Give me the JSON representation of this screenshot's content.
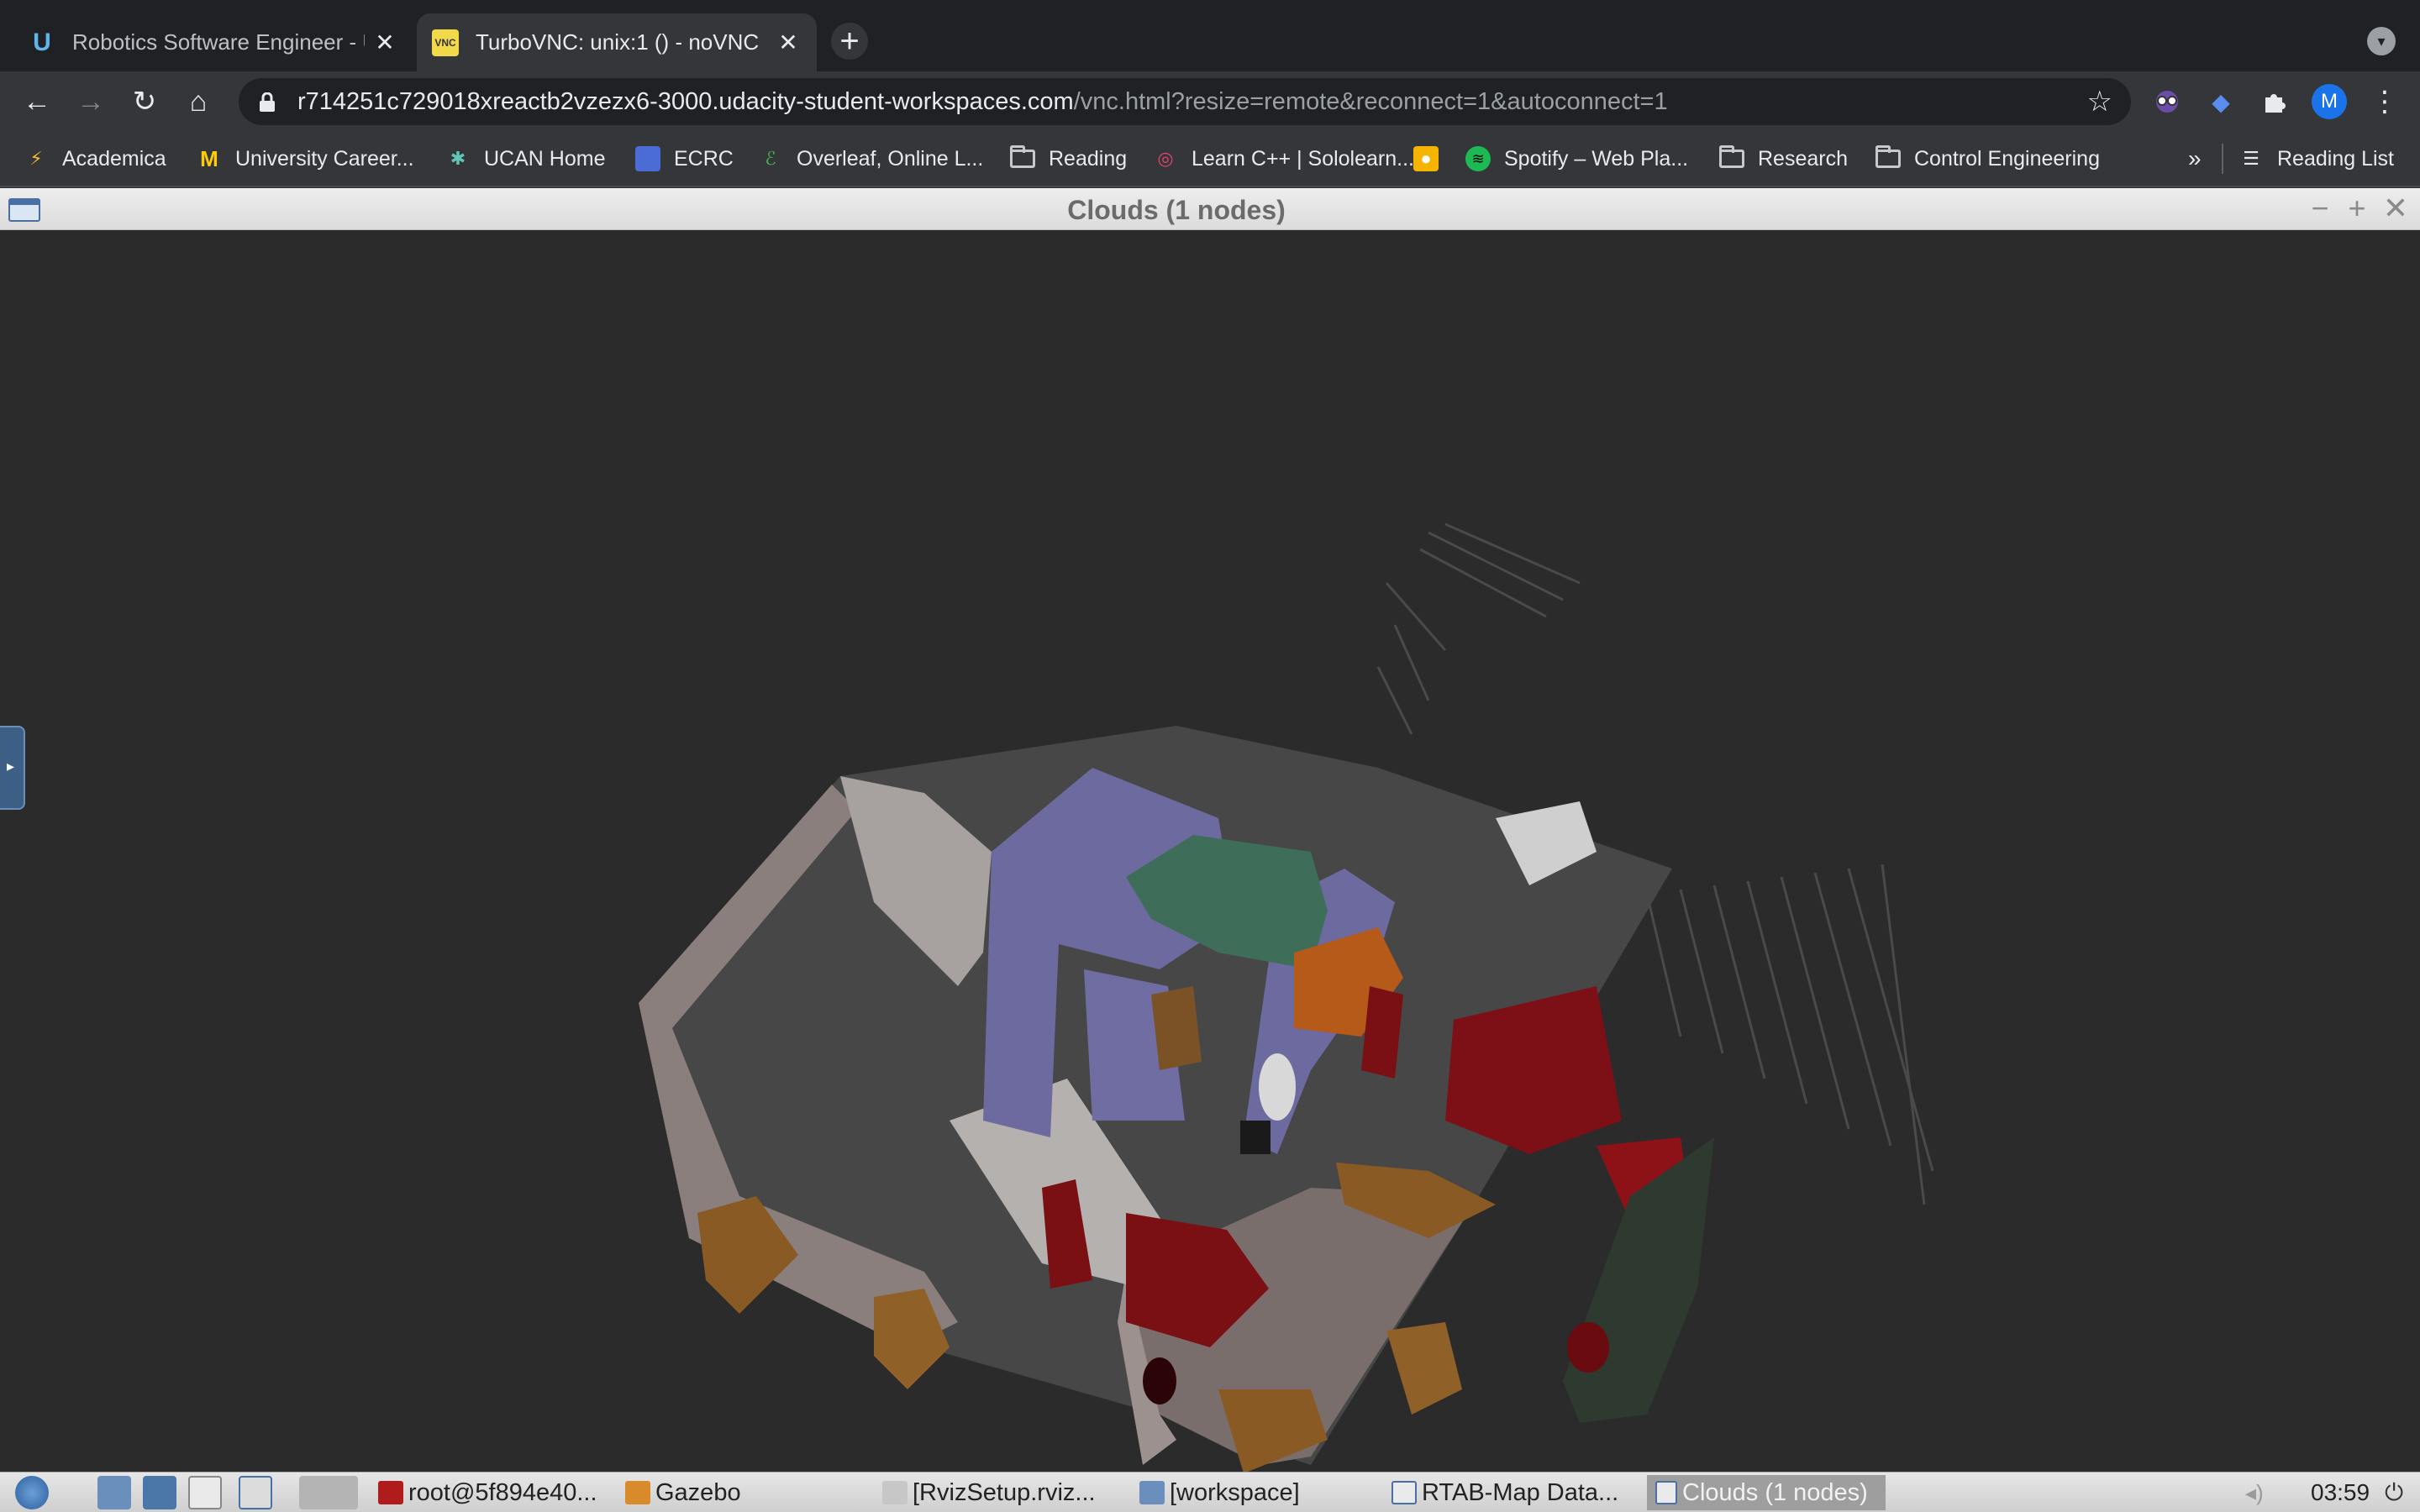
{
  "tabs": [
    {
      "title": "Robotics Software Engineer - U",
      "icon": "udacity-icon",
      "active": false
    },
    {
      "title": "TurboVNC: unix:1 () - noVNC",
      "icon": "vnc-icon",
      "active": true
    }
  ],
  "address": {
    "host": "r714251c729018xreactb2vzezx6-3000.udacity-student-workspaces.com",
    "path": "/vnc.html?resize=remote&reconnect=1&autoconnect=1"
  },
  "profile_initial": "M",
  "bookmarks": [
    {
      "label": "Academica",
      "icon": "academica-icon"
    },
    {
      "label": "University Career...",
      "icon": "michigan-icon"
    },
    {
      "label": "UCAN Home",
      "icon": "ucan-icon"
    },
    {
      "label": "ECRC",
      "icon": "ecrc-icon"
    },
    {
      "label": "Overleaf, Online L...",
      "icon": "overleaf-icon"
    },
    {
      "label": "Reading",
      "icon": "folder-icon"
    },
    {
      "label": "Learn C++ | Sololearn...",
      "icon": "sololearn-icon"
    },
    {
      "label": "",
      "icon": "notes-icon"
    },
    {
      "label": "Spotify – Web Pla...",
      "icon": "spotify-icon"
    },
    {
      "label": "Research",
      "icon": "folder-icon"
    },
    {
      "label": "Control Engineering",
      "icon": "folder-icon"
    }
  ],
  "bookmarks_overflow": "»",
  "reading_list": "Reading List",
  "window": {
    "title": "Clouds (1 nodes)"
  },
  "taskbar": {
    "items": [
      {
        "label": "root@5f894e40...",
        "icon": "terminal-icon"
      },
      {
        "label": "Gazebo",
        "icon": "gazebo-icon"
      },
      {
        "label": "[RvizSetup.rviz...",
        "icon": "rviz-icon"
      },
      {
        "label": "[workspace]",
        "icon": "folder-icon"
      },
      {
        "label": "RTAB-Map Data...",
        "icon": "window-icon"
      },
      {
        "label": "Clouds (1 nodes)",
        "icon": "window-icon"
      }
    ],
    "clock": "03:59"
  },
  "colors": {
    "chrome_dark": "#202124",
    "chrome_tab": "#35363a",
    "scene_bg": "#2b2b2b",
    "wall_purple": "#6b6a9c",
    "wall_red": "#7a0f14",
    "wall_green": "#3e6e5a",
    "floor": "#4a4a4a"
  }
}
